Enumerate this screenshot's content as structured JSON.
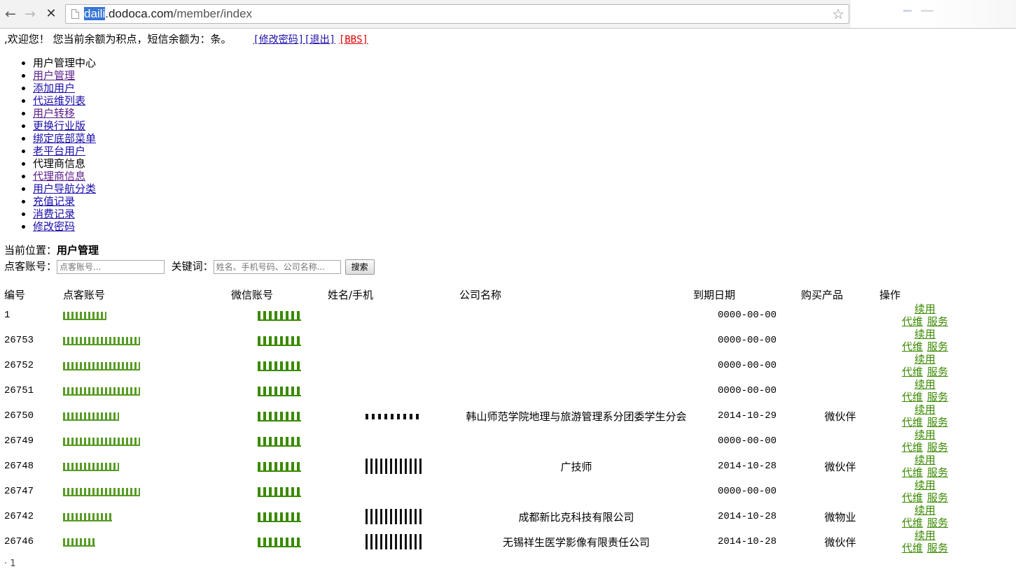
{
  "browser": {
    "url_selected": "daili",
    "url_host_rest": ".dodoca.com",
    "url_path": "/member/index"
  },
  "welcome": {
    "text": ",欢迎您！ 您当前余额为积点，短信余额为：条。",
    "links": [
      "[修改密码]",
      "[退出]",
      "[BBS]"
    ]
  },
  "menu": [
    {
      "label": "用户管理中心",
      "link": false
    },
    {
      "label": "用户管理",
      "link": true,
      "visited": true
    },
    {
      "label": "添加用户",
      "link": true
    },
    {
      "label": "代运维列表",
      "link": true
    },
    {
      "label": "用户转移",
      "link": true,
      "visited": true
    },
    {
      "label": "更换行业版",
      "link": true
    },
    {
      "label": "绑定底部菜单",
      "link": true
    },
    {
      "label": "老平台用户",
      "link": true
    },
    {
      "label": "代理商信息",
      "link": false
    },
    {
      "label": "代理商信息",
      "link": true,
      "visited": true
    },
    {
      "label": "用户导航分类",
      "link": true
    },
    {
      "label": "充值记录",
      "link": true
    },
    {
      "label": "消费记录",
      "link": true
    },
    {
      "label": "修改密码",
      "link": true
    }
  ],
  "breadcrumb": {
    "prefix": "当前位置：",
    "current": "用户管理"
  },
  "search": {
    "account_label": "点客账号：",
    "account_placeholder": "点客账号...",
    "keyword_label": "关键词：",
    "keyword_placeholder": "姓名、手机号码、公司名称...",
    "button": "搜索"
  },
  "table": {
    "headers": [
      "编号",
      "点客账号",
      "微信账号",
      "姓名/手机",
      "公司名称",
      "到期日期",
      "购买产品",
      "操作"
    ],
    "ops": {
      "renew": "续用",
      "maintain": "代维",
      "service": "服务"
    },
    "rows": [
      {
        "id": "1",
        "company": "",
        "date": "0000-00-00",
        "product": ""
      },
      {
        "id": "26753",
        "company": "",
        "date": "0000-00-00",
        "product": ""
      },
      {
        "id": "26752",
        "company": "",
        "date": "0000-00-00",
        "product": ""
      },
      {
        "id": "26751",
        "company": "",
        "date": "0000-00-00",
        "product": ""
      },
      {
        "id": "26750",
        "company": "韩山师范学院地理与旅游管理系分团委学生分会",
        "date": "2014-10-29",
        "product": "微伙伴"
      },
      {
        "id": "26749",
        "company": "",
        "date": "0000-00-00",
        "product": ""
      },
      {
        "id": "26748",
        "company": "广技师",
        "date": "2014-10-28",
        "product": "微伙伴"
      },
      {
        "id": "26747",
        "company": "",
        "date": "0000-00-00",
        "product": ""
      },
      {
        "id": "26742",
        "company": "成都新比克科技有限公司",
        "date": "2014-10-28",
        "product": "微物业"
      },
      {
        "id": "26746",
        "company": "无锡祥生医学影像有限责任公司",
        "date": "2014-10-28",
        "product": "微伙伴"
      }
    ]
  }
}
